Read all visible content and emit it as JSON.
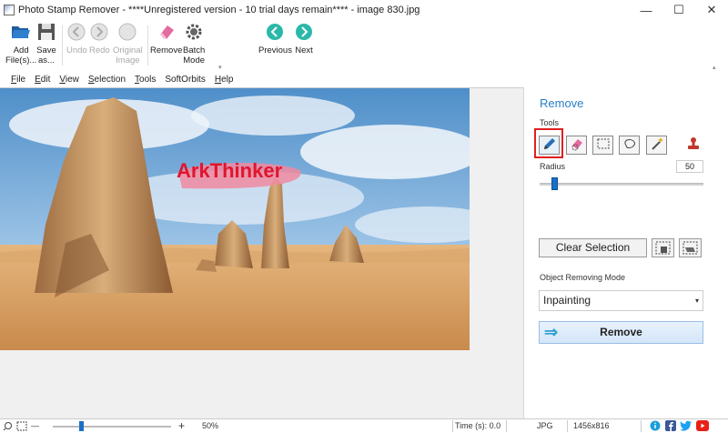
{
  "window": {
    "title": "Photo Stamp Remover - ****Unregistered version - 10 trial days remain**** - image 830.jpg",
    "minimize": "—",
    "maximize": "☐",
    "close": "✕"
  },
  "toolbar": {
    "add_files": [
      "Add",
      "File(s)..."
    ],
    "save_as": [
      "Save",
      "as..."
    ],
    "undo": "Undo",
    "redo": "Redo",
    "original_image": [
      "Original",
      "Image"
    ],
    "remove": "Remove",
    "batch_mode": [
      "Batch",
      "Mode"
    ],
    "previous": "Previous",
    "next": "Next"
  },
  "menu": [
    {
      "u": "F",
      "rest": "ile"
    },
    {
      "u": "E",
      "rest": "dit"
    },
    {
      "u": "V",
      "rest": "iew"
    },
    {
      "u": "S",
      "rest": "election"
    },
    {
      "u": "T",
      "rest": "ools"
    },
    {
      "u": "",
      "rest": "SoftOrbits"
    },
    {
      "u": "H",
      "rest": "elp"
    }
  ],
  "image": {
    "watermark": "ArkThinker"
  },
  "panel": {
    "title": "Remove",
    "tools_label": "Tools",
    "radius_label": "Radius",
    "radius_value": "50",
    "radius_fraction": 0.07,
    "clear_selection": "Clear Selection",
    "mode_label": "Object Removing Mode",
    "mode_value": "Inpainting",
    "remove_button": "Remove"
  },
  "status": {
    "zoom": "50%",
    "time": "Time (s): 0.0",
    "format": "JPG",
    "dimensions": "1456x816"
  }
}
